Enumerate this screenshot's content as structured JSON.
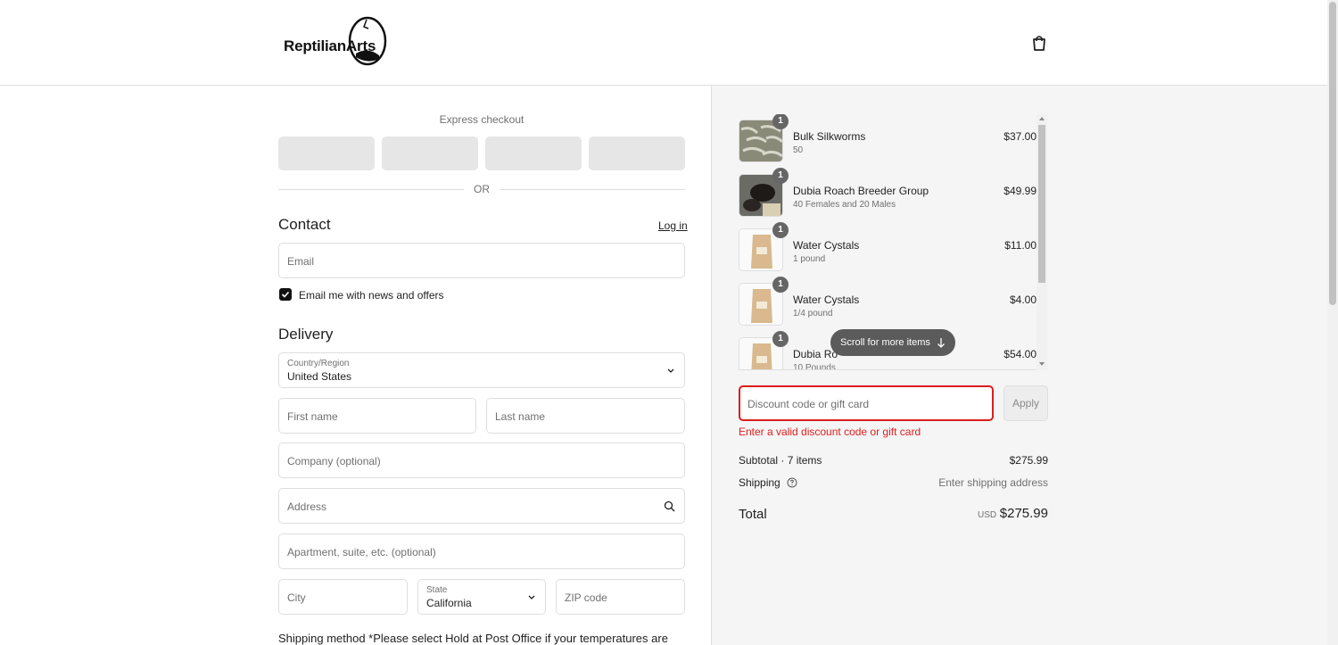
{
  "brand": {
    "name": "ReptilianArts"
  },
  "header": {
    "cart_icon": "shopping-bag-icon"
  },
  "express": {
    "title": "Express checkout",
    "or": "OR"
  },
  "contact": {
    "title": "Contact",
    "login": "Log in",
    "email_placeholder": "Email",
    "newsletter_label": "Email me with news and offers",
    "newsletter_checked": true
  },
  "delivery": {
    "title": "Delivery",
    "country_label": "Country/Region",
    "country_value": "United States",
    "first_name": "First name",
    "last_name": "Last name",
    "company": "Company (optional)",
    "address": "Address",
    "apartment": "Apartment, suite, etc. (optional)",
    "city": "City",
    "state_label": "State",
    "state_value": "California",
    "zip": "ZIP code"
  },
  "shipping_method": {
    "text": "Shipping method *Please select Hold at Post Office if your temperatures are"
  },
  "cart": {
    "items": [
      {
        "qty": "1",
        "name": "Bulk Silkworms",
        "variant": "50",
        "price": "$37.00"
      },
      {
        "qty": "1",
        "name": "Dubia Roach Breeder Group",
        "variant": "40 Females and 20 Males",
        "price": "$49.99"
      },
      {
        "qty": "1",
        "name": "Water Cystals",
        "variant": "1 pound",
        "price": "$11.00"
      },
      {
        "qty": "1",
        "name": "Water Cystals",
        "variant": "1/4 pound",
        "price": "$4.00"
      },
      {
        "qty": "1",
        "name": "Dubia Ro",
        "variant": "10 Pounds",
        "price": "$54.00"
      }
    ],
    "scroll_hint": "Scroll for more items"
  },
  "discount": {
    "placeholder": "Discount code or gift card",
    "apply": "Apply",
    "error": "Enter a valid discount code or gift card"
  },
  "summary": {
    "subtotal_label": "Subtotal · 7 items",
    "subtotal_value": "$275.99",
    "shipping_label": "Shipping",
    "shipping_value": "Enter shipping address",
    "total_label": "Total",
    "currency": "USD",
    "total_value": "$275.99"
  },
  "colors": {
    "error": "#dd1d1d",
    "badge": "#666666",
    "panel": "#f5f5f5"
  }
}
